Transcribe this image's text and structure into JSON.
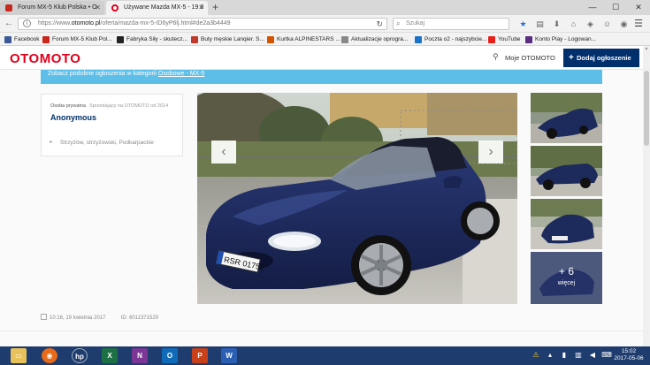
{
  "browser": {
    "tabs": [
      {
        "label": "Forum MX-5 Klub Polska • O",
        "active": false,
        "favicon_color": "#c8281e"
      },
      {
        "label": "Używane Mazda MX-5 - 19 0",
        "active": true,
        "favicon_color": "#e2001a"
      }
    ],
    "new_tab": "+",
    "window_controls": {
      "minimize": "—",
      "maximize": "☐",
      "close": "✕"
    },
    "url_prefix": "https://www.",
    "url_domain": "otomoto.pl",
    "url_rest": "/oferta/mazda-mx-5-ID6yP6lj.html#de2a3b4449",
    "search_placeholder": "Szukaj",
    "bookmarks": [
      {
        "label": "Facebook",
        "color": "#3b5998"
      },
      {
        "label": "Forum MX-5 Klub Pol...",
        "color": "#c8281e"
      },
      {
        "label": "Fabryka Siły - skutecz...",
        "color": "#222222"
      },
      {
        "label": "Buty męskie Lanqier. S...",
        "color": "#c0392b"
      },
      {
        "label": "Kurtka ALPINESTARS ...",
        "color": "#d35400"
      },
      {
        "label": "Aktualizacje oprogra...",
        "color": "#888888"
      },
      {
        "label": "Poczta o2 - najszybcie...",
        "color": "#1a73c8"
      },
      {
        "label": "YouTube",
        "color": "#e62117"
      },
      {
        "label": "Konto Play - Logowan...",
        "color": "#5a2d82"
      }
    ]
  },
  "header": {
    "logo": "OTOMOTO",
    "my_account": "Moje OTOMOTO",
    "add_listing": "Dodaj ogłoszenie"
  },
  "banner": {
    "prefix": "Zobacz podobne ogłoszenia w kategorii ",
    "category": "Osobowe - MX-5"
  },
  "seller": {
    "type": "Osoba prywatna",
    "since": "Sprzedający na OTOMOTO od 2014",
    "name": "Anonymous",
    "location": "Strzyżów, strzyżowski, Podkarpackie"
  },
  "gallery": {
    "prev": "‹",
    "next": "›",
    "more_count": "+ 6",
    "more_label": "więcej",
    "plate": "RSR 01752"
  },
  "listing_meta": {
    "date": "10:16, 19 kwietnia 2017",
    "id": "ID: 6011371529"
  },
  "taskbar": {
    "time": "15:02",
    "date": "2017-05-06"
  },
  "colors": {
    "brand_red": "#e2001a",
    "navy": "#002f6c",
    "banner_blue": "#5dbfe8",
    "car_blue": "#1d2a5c"
  }
}
